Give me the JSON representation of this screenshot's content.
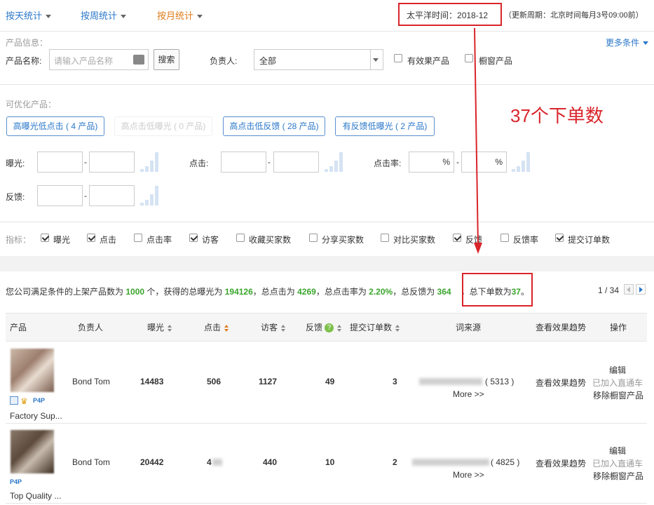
{
  "tabs": {
    "weekly_by_day": "按天统计",
    "weekly": "按周统计",
    "monthly": "按月统计"
  },
  "timebar": {
    "pacific_label": "太平洋时间：",
    "pacific_value": "2018-12",
    "update_note": "（更新周期：北京时间每月3号09:00前）"
  },
  "filters": {
    "section_label": "产品信息：",
    "more_conditions": "更多条件",
    "product_name_label": "产品名称:",
    "product_name_placeholder": "请输入产品名称",
    "search_button": "搜索",
    "owner_label": "负责人:",
    "owner_value": "全部",
    "effective_products": "有效果产品",
    "window_products": "橱窗产品"
  },
  "optimize": {
    "section_label": "可优化产品：",
    "pills": [
      "高曝光低点击 ( 4 产品)",
      "高点击低曝光 ( 0 产品)",
      "高点击低反馈 ( 28 产品)",
      "有反馈低曝光 ( 2 产品)"
    ],
    "exposure_label": "曝光:",
    "click_label": "点击:",
    "ctr_label": "点击率:",
    "feedback_label": "反馈:",
    "percent": "%",
    "dash": "-"
  },
  "annotation": "37个下单数",
  "metrics": {
    "label": "指标：",
    "items": [
      {
        "label": "曝光",
        "checked": true
      },
      {
        "label": "点击",
        "checked": true
      },
      {
        "label": "点击率",
        "checked": false
      },
      {
        "label": "访客",
        "checked": true
      },
      {
        "label": "收藏买家数",
        "checked": false
      },
      {
        "label": "分享买家数",
        "checked": false
      },
      {
        "label": "对比买家数",
        "checked": false
      },
      {
        "label": "反馈",
        "checked": true
      },
      {
        "label": "反馈率",
        "checked": false
      },
      {
        "label": "提交订单数",
        "checked": true
      }
    ]
  },
  "summary": {
    "p1": "您公司满足条件的上架产品数为 ",
    "products": "1000",
    "p2": " 个，获得的总曝光为 ",
    "exposure": "194126",
    "p3": "，总点击为 ",
    "clicks": "4269",
    "p4": "，总点击率为 ",
    "ctr": "2.20%",
    "p5": "，总反馈为 ",
    "feedback": "364",
    "p6": "，总下单数为",
    "orders": "37",
    "p7": "。",
    "pagination": "1 / 34"
  },
  "table": {
    "headers": {
      "product": "产品",
      "owner": "负责人",
      "exposure": "曝光",
      "clicks": "点击",
      "visitors": "访客",
      "feedback": "反馈",
      "orders": "提交订单数",
      "source": "词来源",
      "trend": "查看效果趋势",
      "ops": "操作"
    },
    "rows": [
      {
        "name": "Factory Sup...",
        "owner": "Bond Tom",
        "exposure": "14483",
        "clicks": "506",
        "visitors": "1127",
        "feedback": "49",
        "orders": "3",
        "source_count": "( 5313 )",
        "more": "More >>",
        "trend": "查看效果趋势",
        "op_edit": "编辑",
        "op_added": "已加入直通车",
        "op_remove": "移除橱窗产品",
        "badge": "P4P"
      },
      {
        "name": "Top Quality ...",
        "owner": "Bond Tom",
        "exposure": "20442",
        "clicks": "4",
        "visitors": "440",
        "feedback": "10",
        "orders": "2",
        "source_count": "( 4825 )",
        "more": "More >>",
        "trend": "查看效果趋势",
        "op_edit": "编辑",
        "op_added": "已加入直通车",
        "op_remove": "移除橱窗产品",
        "badge": "P4P"
      }
    ]
  },
  "colors": {
    "accent_blue": "#2a77c9",
    "accent_orange": "#e07b1a",
    "highlight_red": "#d9252b",
    "value_green": "#3aa52c"
  }
}
